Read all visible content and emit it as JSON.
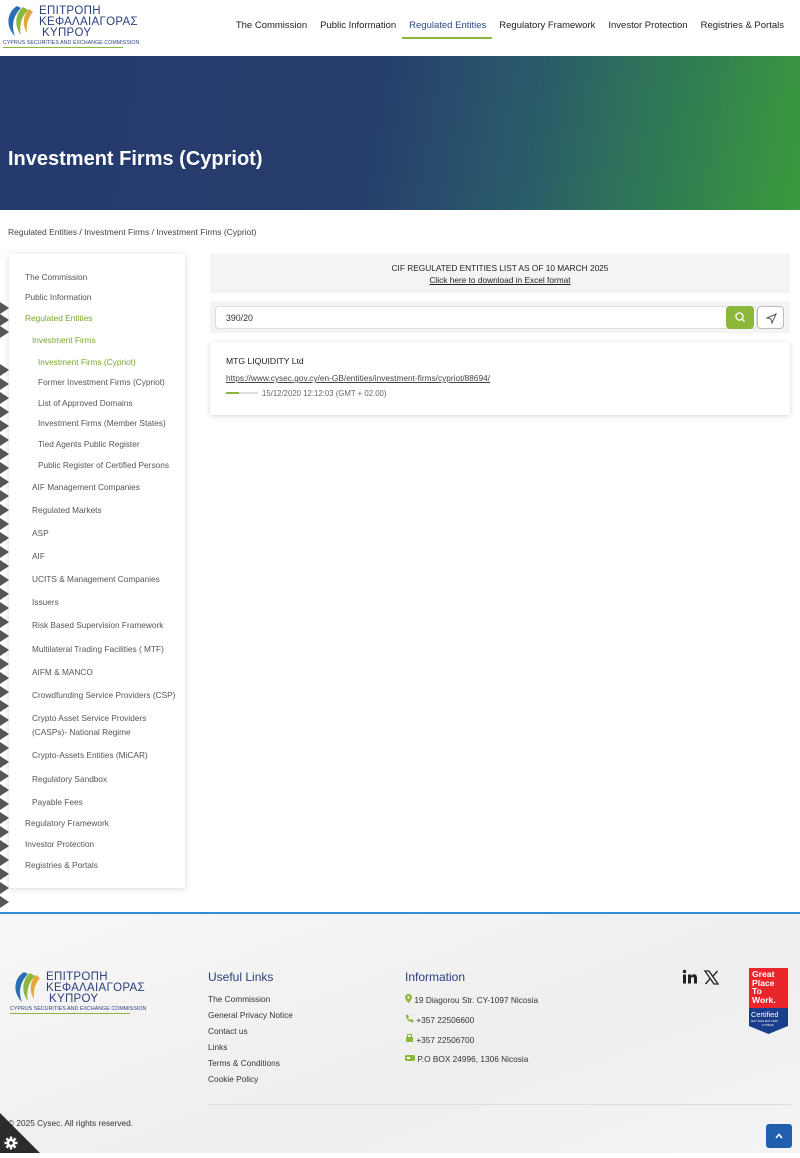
{
  "header": {
    "logo": {
      "line1": "ΕΠΙΤΡΟΠΗ",
      "line2": "ΚΕΦΑΛΑΙΑΓΟΡΑΣ",
      "line3": "ΚΥΠΡΟΥ",
      "subtitle": "CYPRUS SECURITIES AND EXCHANGE COMMISSION"
    },
    "nav": [
      "The Commission",
      "Public Information",
      "Regulated Entities",
      "Regulatory Framework",
      "Investor Protection",
      "Registries & Portals"
    ],
    "active_nav": "Regulated Entities"
  },
  "hero": {
    "title": "Investment Firms (Cypriot)"
  },
  "breadcrumb": "Regulated Entities / Investment Firms / Investment Firms (Cypriot)",
  "sidebar": {
    "items": [
      {
        "label": "The Commission",
        "level": 0
      },
      {
        "label": "Public Information",
        "level": 0
      },
      {
        "label": "Regulated Entities",
        "level": 0,
        "active": true
      },
      {
        "label": "Investment Firms",
        "level": 1,
        "active": true
      },
      {
        "label": "Investment Firms (Cypriot)",
        "level": 2,
        "active": true
      },
      {
        "label": "Former Investment Firms (Cypriot)",
        "level": 2
      },
      {
        "label": "List of Approved Domains",
        "level": 2
      },
      {
        "label": "Investment Firms (Member States)",
        "level": 2
      },
      {
        "label": "Tied Agents Public Register",
        "level": 2
      },
      {
        "label": "Public Register of Certified Persons",
        "level": 2
      },
      {
        "label": "AIF Management Companies",
        "level": 1
      },
      {
        "label": "Regulated Markets",
        "level": 1
      },
      {
        "label": "ASP",
        "level": 1
      },
      {
        "label": "AIF",
        "level": 1
      },
      {
        "label": "UCITS & Management Companies",
        "level": 1
      },
      {
        "label": "Issuers",
        "level": 1
      },
      {
        "label": "Risk Based Supervision Framework",
        "level": 1
      },
      {
        "label": "Multilateral Trading Facilities ( MTF)",
        "level": 1
      },
      {
        "label": "AIFM & MANCO",
        "level": 1
      },
      {
        "label": "Crowdfunding Service Providers (CSP)",
        "level": 1
      },
      {
        "label": "Crypto Asset Service Providers",
        "level": 1
      },
      {
        "label": "(CASPs)- National Regime",
        "level": 1
      },
      {
        "label": "Crypto-Assets Entities (MiCAR)",
        "level": 1
      },
      {
        "label": "Regulatory Sandbox",
        "level": 1
      },
      {
        "label": "Payable Fees",
        "level": 1
      },
      {
        "label": "Regulatory Framework",
        "level": 0
      },
      {
        "label": "Investor Protection",
        "level": 0
      },
      {
        "label": "Registries & Portals",
        "level": 0
      }
    ]
  },
  "banner": {
    "title": "CIF REGULATED ENTITIES LIST AS OF 10 MARCH 2025",
    "link": "Click here to download in Excel format"
  },
  "search": {
    "value": "390/20",
    "search_icon": "search-icon",
    "send_icon": "send-icon"
  },
  "result": {
    "name": "MTG LIQUIDITY Ltd",
    "url": "https://www.cysec.gov.cy/en-GB/entities/investment-firms/cypriot/88694/",
    "date": "15/12/2020 12:12:03 (GMT + 02.00)"
  },
  "footer": {
    "useful_links_title": "Useful Links",
    "useful_links": [
      "The Commission",
      "General Privacy Notice",
      "Contact us",
      "Links",
      "Terms & Conditions",
      "Cookie Policy"
    ],
    "info_title": "Information",
    "info": [
      {
        "icon": "map-pin-icon",
        "text": "19 Diagorou Str. CY-1097 Nicosia"
      },
      {
        "icon": "phone-icon",
        "text": "+357 22506600"
      },
      {
        "icon": "fax-icon",
        "text": "+357 22506700"
      },
      {
        "icon": "mailbox-icon",
        "text": "P.O BOX 24996, 1306 Nicosia"
      }
    ],
    "social": [
      "linkedin-icon",
      "x-icon"
    ],
    "badge": {
      "line1": "Great",
      "line2": "Place",
      "line3": "To",
      "line4": "Work.",
      "certified": "Certified",
      "dates": "MAY 2024-MAY 2025",
      "country": "CYPRUS"
    },
    "copyright": "© 2025 Cysec. All rights reserved."
  },
  "colors": {
    "brand_blue": "#253a6e",
    "brand_green": "#8bb83a",
    "link_blue": "#1f5fae"
  }
}
